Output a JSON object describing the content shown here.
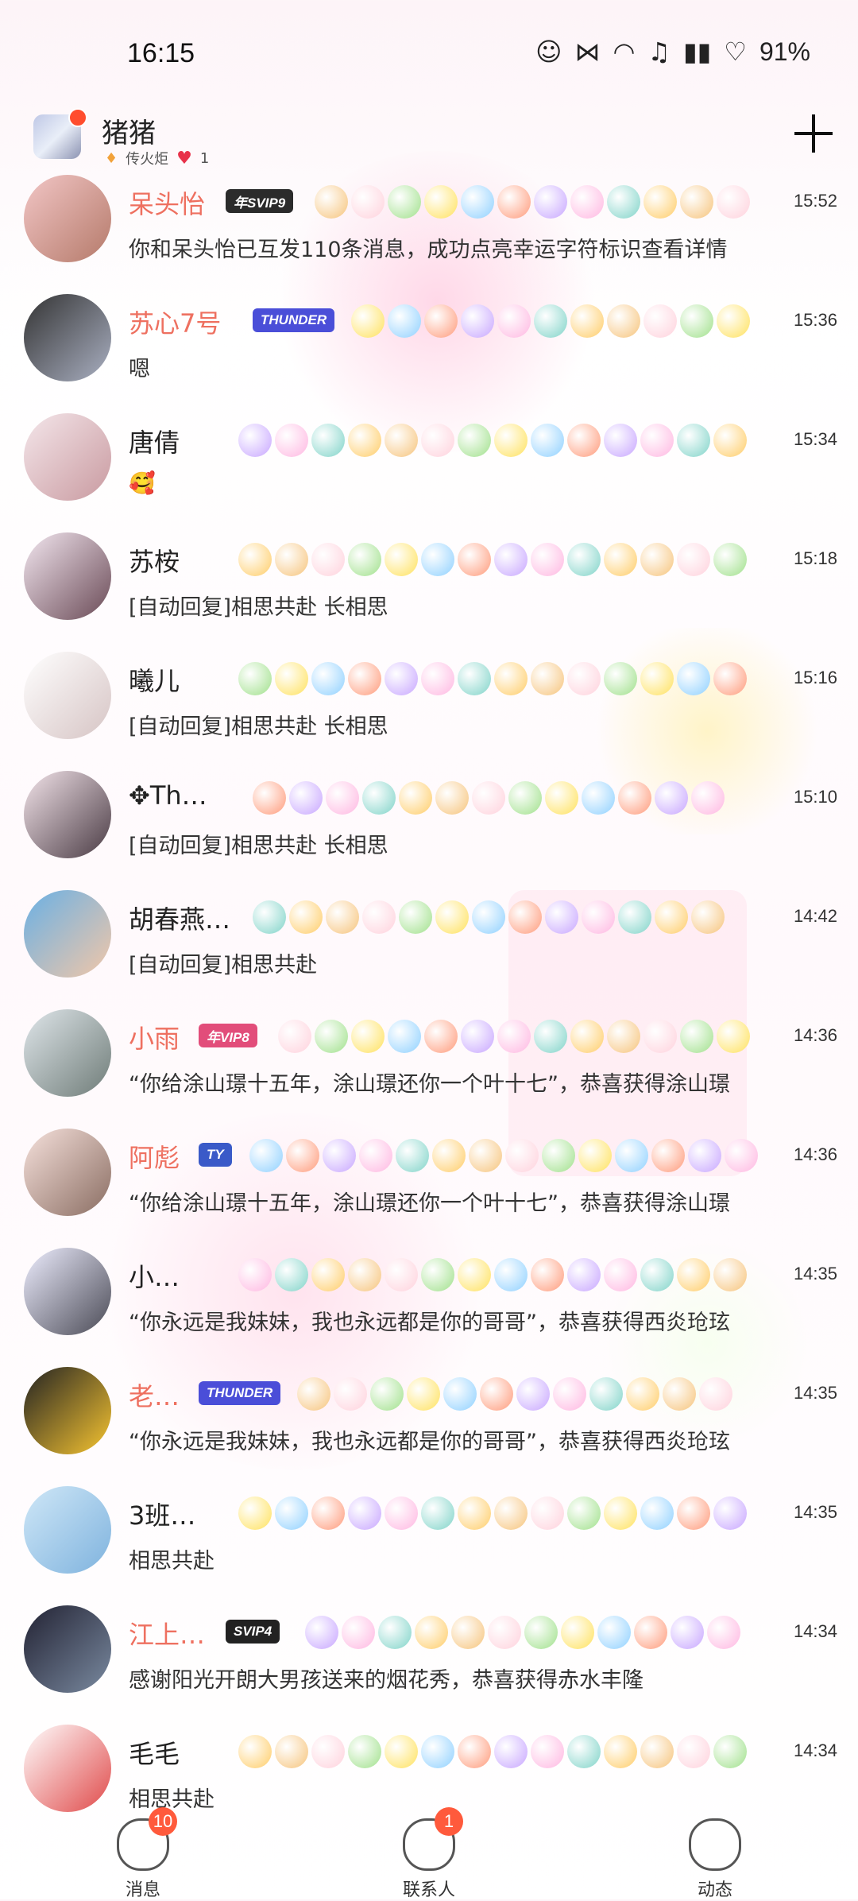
{
  "status_bar": {
    "time": "16:15",
    "battery": "91%"
  },
  "header": {
    "name": "猪猪",
    "flame_label": "传火炬",
    "like_count": "1"
  },
  "chats": [
    {
      "name": "呆头怡",
      "badge": "年SVIP9",
      "time": "15:52",
      "preview": "你和呆头怡已互发110条消息，成功点亮幸运字符标识查看详情"
    },
    {
      "name": "苏心7号",
      "badge": "THUNDER",
      "time": "15:36",
      "preview": "嗯"
    },
    {
      "name": "唐倩",
      "badge": "",
      "time": "15:34",
      "preview": "🥰"
    },
    {
      "name": "苏桉",
      "badge": "",
      "time": "15:18",
      "preview": "[自动回复]相思共赴 长相思"
    },
    {
      "name": "曦儿",
      "badge": "",
      "time": "15:16",
      "preview": "[自动回复]相思共赴 长相思"
    },
    {
      "name": "✥Th…",
      "badge": "",
      "time": "15:10",
      "preview": "[自动回复]相思共赴 长相思"
    },
    {
      "name": "胡春燕…",
      "badge": "",
      "time": "14:42",
      "preview": "[自动回复]相思共赴"
    },
    {
      "name": "小雨",
      "badge": "年VIP8",
      "time": "14:36",
      "preview": "“你给涂山璟十五年，涂山璟还你一个叶十七”，恭喜获得涂山璟"
    },
    {
      "name": "阿彪",
      "badge": "TY",
      "time": "14:36",
      "preview": "“你给涂山璟十五年，涂山璟还你一个叶十七”，恭喜获得涂山璟"
    },
    {
      "name": "小…",
      "badge": "",
      "time": "14:35",
      "preview": "“你永远是我妹妹，我也永远都是你的哥哥”，恭喜获得西炎玱玹"
    },
    {
      "name": "老…",
      "badge": "THUNDER",
      "time": "14:35",
      "preview": "“你永远是我妹妹，我也永远都是你的哥哥”，恭喜获得西炎玱玹"
    },
    {
      "name": "3班…",
      "badge": "",
      "time": "14:35",
      "preview": "相思共赴"
    },
    {
      "name": "江上…",
      "badge": "SVIP4",
      "time": "14:34",
      "preview": "感谢阳光开朗大男孩送来的烟花秀，恭喜获得赤水丰隆"
    },
    {
      "name": "毛毛",
      "badge": "",
      "time": "14:34",
      "preview": "相思共赴"
    }
  ],
  "tabs": [
    {
      "label": "消息",
      "badge": "10"
    },
    {
      "label": "联系人",
      "badge": "1"
    },
    {
      "label": "动态",
      "badge": ""
    }
  ],
  "colors": {
    "accent_red": "#ff5a3c",
    "name_pink": "#ee7060",
    "badge_blue": "#4a4ed8"
  }
}
